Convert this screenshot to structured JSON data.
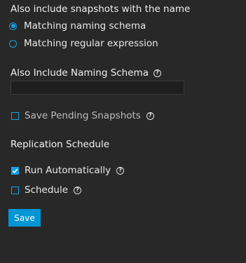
{
  "snapshot_name_options": {
    "heading": "Also include snapshots with the name",
    "options": [
      {
        "label": "Matching naming schema",
        "selected": true
      },
      {
        "label": "Matching regular expression",
        "selected": false
      }
    ]
  },
  "naming_schema": {
    "label": "Also Include Naming Schema",
    "value": "",
    "placeholder": ""
  },
  "save_pending": {
    "label": "Save Pending Snapshots",
    "checked": false
  },
  "replication_schedule": {
    "heading": "Replication Schedule",
    "run_automatically": {
      "label": "Run Automatically",
      "checked": true
    },
    "schedule": {
      "label": "Schedule",
      "checked": false
    }
  },
  "actions": {
    "save_label": "Save"
  },
  "colors": {
    "background": "#282828",
    "accent": "#0095d5"
  },
  "help_icon_glyph": "?"
}
